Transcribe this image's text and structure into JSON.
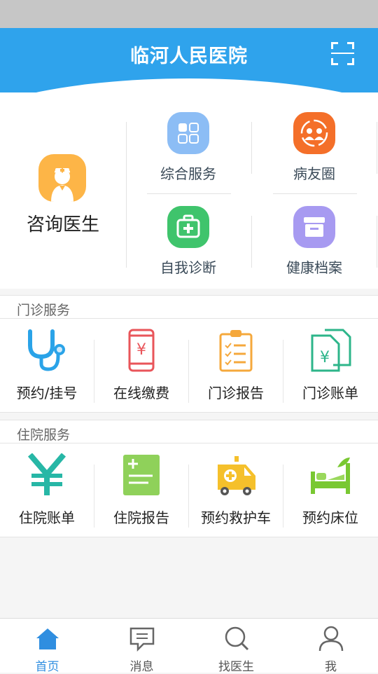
{
  "header": {
    "title": "临河人民医院"
  },
  "quick": {
    "consult": "咨询医生",
    "items": [
      {
        "label": "综合服务",
        "color": "#8cbdf5"
      },
      {
        "label": "病友圈",
        "color": "#f46f29"
      },
      {
        "label": "自我诊断",
        "color": "#3fc46c"
      },
      {
        "label": "健康档案",
        "color": "#a79af1"
      }
    ]
  },
  "outpatient": {
    "title": "门诊服务",
    "items": [
      {
        "label": "预约/挂号",
        "icon": "stethoscope-icon"
      },
      {
        "label": "在线缴费",
        "icon": "phone-payment-icon"
      },
      {
        "label": "门诊报告",
        "icon": "clipboard-icon"
      },
      {
        "label": "门诊账单",
        "icon": "bill-icon"
      }
    ]
  },
  "inpatient": {
    "title": "住院服务",
    "items": [
      {
        "label": "住院账单",
        "icon": "yen-icon"
      },
      {
        "label": "住院报告",
        "icon": "report-icon"
      },
      {
        "label": "预约救护车",
        "icon": "ambulance-icon"
      },
      {
        "label": "预约床位",
        "icon": "bed-icon"
      }
    ]
  },
  "tabs": [
    {
      "label": "首页",
      "icon": "home-icon",
      "active": true
    },
    {
      "label": "消息",
      "icon": "message-icon"
    },
    {
      "label": "找医生",
      "icon": "search-icon"
    },
    {
      "label": "我",
      "icon": "user-icon"
    }
  ]
}
